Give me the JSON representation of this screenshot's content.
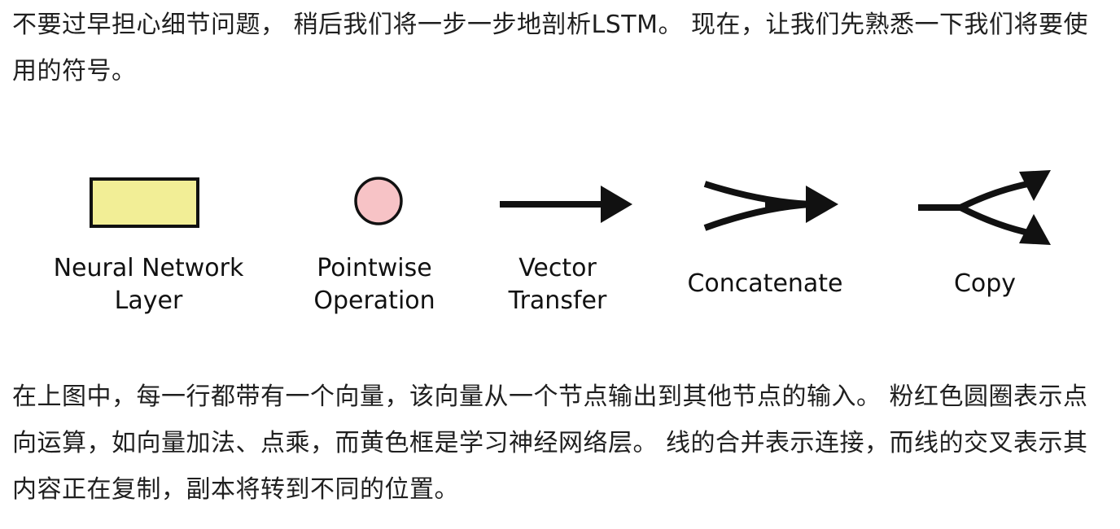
{
  "paragraphs": {
    "intro": "不要过早担心细节问题， 稍后我们将一步一步地剖析LSTM。 现在，让我们先熟悉一下我们将要使用的符号。",
    "explanation": "在上图中，每一行都带有一个向量，该向量从一个节点输出到其他节点的输入。 粉红色圆圈表示点向运算，如向量加法、点乘，而黄色框是学习神经网络层。 线的合并表示连接，而线的交叉表示其内容正在复制，副本将转到不同的位置。"
  },
  "legend": {
    "items": [
      {
        "label": "Neural Network\nLayer",
        "icon": "yellow-rectangle",
        "color": "#f2ee96"
      },
      {
        "label": "Pointwise\nOperation",
        "icon": "pink-circle",
        "color": "#f7c3c6"
      },
      {
        "label": "Vector\nTransfer",
        "icon": "arrow"
      },
      {
        "label": "Concatenate",
        "icon": "merge-arrow"
      },
      {
        "label": "Copy",
        "icon": "split-arrow"
      }
    ]
  }
}
